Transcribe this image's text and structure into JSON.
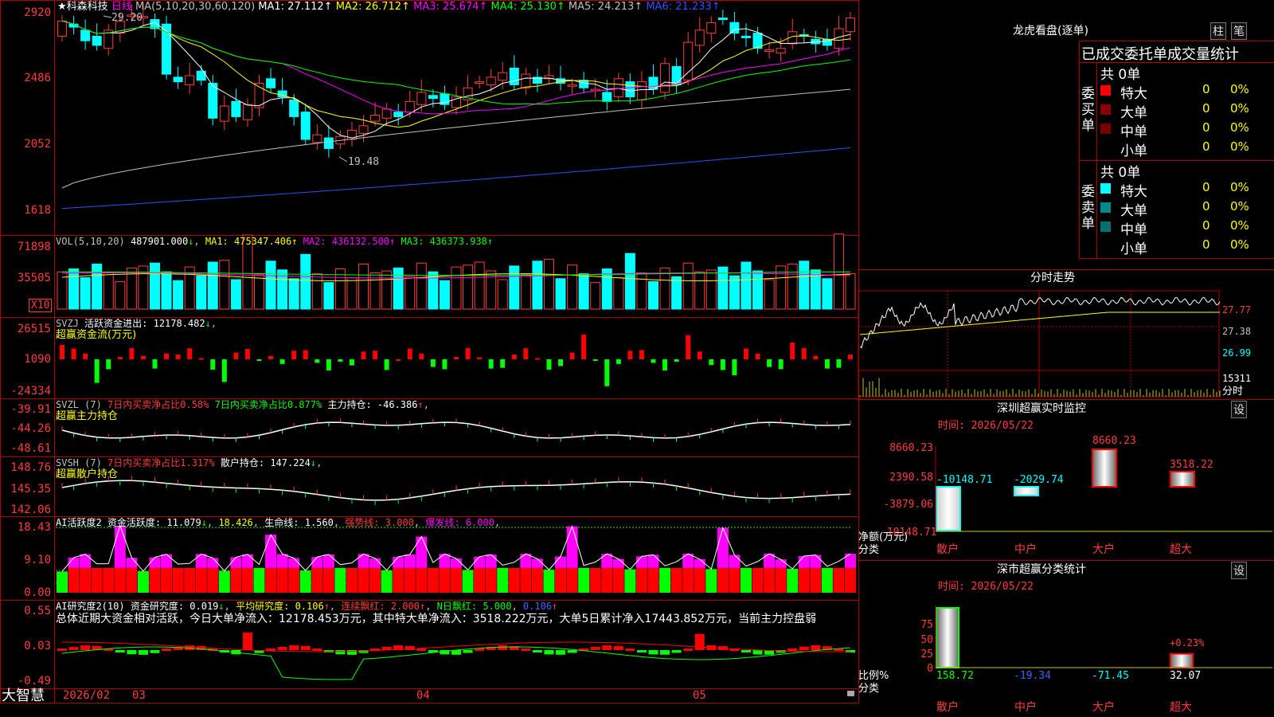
{
  "stock": {
    "name": "科森科技",
    "star": "★",
    "period": "日线"
  },
  "kline": {
    "ma_label": "MA(5,10,20,30,60,120)",
    "ma": [
      {
        "label": "MA1:",
        "value": "27.112",
        "color": "#ffffff"
      },
      {
        "label": "MA2:",
        "value": "26.712",
        "color": "#ffff00"
      },
      {
        "label": "MA3:",
        "value": "25.674",
        "color": "#ff00ff"
      },
      {
        "label": "MA4:",
        "value": "25.130",
        "color": "#00ff00"
      },
      {
        "label": "MA5:",
        "value": "24.213",
        "color": "#c0c0c0"
      },
      {
        "label": "MA6:",
        "value": "21.233",
        "color": "#3050ff"
      }
    ],
    "yticks": [
      "2920",
      "2486",
      "2052",
      "1618"
    ],
    "high_mark": "29.20",
    "low_mark": "19.48"
  },
  "vol": {
    "label": "VOL(5,10,20)",
    "value": "487901.000",
    "ma": [
      {
        "label": "MA1:",
        "value": "475347.406",
        "color": "#ffff00"
      },
      {
        "label": "MA2:",
        "value": "436132.500",
        "color": "#ff00ff"
      },
      {
        "label": "MA3:",
        "value": "436373.938",
        "color": "#00ff00"
      }
    ],
    "yticks": [
      "71898",
      "35505"
    ],
    "unit": "X10"
  },
  "svzj": {
    "label": "SVZJ",
    "desc": "活跃资金进出:",
    "value": "12178.482",
    "subtitle": "超赢资金流(万元)",
    "yticks": [
      "26515",
      "1090",
      "-24334"
    ]
  },
  "svzl": {
    "label": "SVZL (7)",
    "t1": "7日内买卖净占比0.58%",
    "t2": "7日内买卖净占比0.877%",
    "t3": "主力持仓:",
    "v3": "-46.386",
    "subtitle": "超赢主力持仓",
    "yticks": [
      "-39.91",
      "-44.26",
      "-48.61"
    ]
  },
  "svsh": {
    "label": "SVSH (7)",
    "t1": "7日内买卖净占比1.317%",
    "t2": "散户持仓:",
    "v2": "147.224",
    "subtitle": "超赢散户持仓",
    "yticks": [
      "148.76",
      "145.35",
      "142.06"
    ]
  },
  "ai1": {
    "label": "AI活跃度2",
    "t1": "资金活跃度:",
    "v1": "11.079",
    "v2": "18.426",
    "t3": "生命线:",
    "v3": "1.560",
    "t4": "强势线:",
    "v4": "3.000",
    "t5": "爆发线:",
    "v5": "6.000",
    "yticks": [
      "18.43",
      "9.10",
      "0.00"
    ]
  },
  "ai2": {
    "label": "AI研究度2(10)",
    "t1": "资金研究度:",
    "v1": "0.019",
    "t2": "平均研究度:",
    "v2": "0.106",
    "t3": "连续飘红:",
    "v3": "2.000",
    "t4": "N日飘红:",
    "v4": "5.000",
    "v5": "0.106",
    "summary": "总体近期大资金相对活跃，今日大单净流入：12178.453万元，其中特大单净流入：3518.222万元，大单5日累计净入17443.852万元，当前主力控盘弱",
    "yticks": [
      "0.55",
      "0.03",
      "-0.49"
    ]
  },
  "xaxis": {
    "brand": "大智慧",
    "labels": [
      "2026/02",
      "03",
      "04",
      "05"
    ]
  },
  "lhb": {
    "title": "龙虎看盘(逐单)",
    "btn1": "柱",
    "btn2": "笔",
    "header": "已成交委托单成交量统计",
    "buy": {
      "side": "委买单",
      "total": "共 0单",
      "rows": [
        {
          "name": "特大",
          "count": "0",
          "pct": "0%",
          "color": "#ff0000"
        },
        {
          "name": "大单",
          "count": "0",
          "pct": "0%",
          "color": "#8b0000"
        },
        {
          "name": "中单",
          "count": "0",
          "pct": "0%",
          "color": "#7a0000"
        },
        {
          "name": "小单",
          "count": "0",
          "pct": "0%",
          "color": ""
        }
      ]
    },
    "sell": {
      "side": "委卖单",
      "total": "共 0单",
      "rows": [
        {
          "name": "特大",
          "count": "0",
          "pct": "0%",
          "color": "#00ffff"
        },
        {
          "name": "大单",
          "count": "0",
          "pct": "0%",
          "color": "#008b8b"
        },
        {
          "name": "中单",
          "count": "0",
          "pct": "0%",
          "color": "#007070"
        },
        {
          "name": "小单",
          "count": "0",
          "pct": "0%",
          "color": ""
        }
      ]
    }
  },
  "fenshi": {
    "title": "分时走势",
    "p1": "27.77",
    "p2": "27.38",
    "p3": "26.99",
    "vol": "15311",
    "unit": "分时"
  },
  "monitor": {
    "title": "深圳超赢实时监控",
    "btn": "设",
    "time": "时间: 2026/05/22",
    "yticks": [
      "8660.23",
      "2390.58",
      "-3879.06",
      "-10148.71"
    ],
    "ylabel": "净额(万元)",
    "xlabel": "分类",
    "categories": [
      "散户",
      "中户",
      "大户",
      "超大"
    ],
    "values": [
      "-10148.71",
      "-2029.74",
      "8660.23",
      "3518.22"
    ]
  },
  "classify": {
    "title": "深市超赢分类统计",
    "btn": "设",
    "time": "时间: 2026/05/22",
    "yticks": [
      "75",
      "50",
      "25",
      "0"
    ],
    "ylabel": "比例%",
    "xlabel": "分类",
    "categories": [
      "散户",
      "中户",
      "大户",
      "超大"
    ],
    "values": [
      "158.72",
      "-19.34",
      "-71.45",
      "32.07"
    ],
    "pct_label": "+0.23%"
  },
  "chart_data": [
    {
      "type": "candlestick",
      "title": "科森科技 日线",
      "ylim": [
        16.18,
        29.2
      ],
      "x": [
        "2026/02",
        "03",
        "04",
        "05"
      ],
      "close": [
        28.6,
        28.2,
        27.3,
        27.0,
        28.0,
        28.6,
        29.0,
        28.9,
        28.1,
        25.1,
        24.6,
        25.0,
        24.7,
        22.2,
        23.0,
        22.3,
        23.1,
        24.5,
        24.2,
        23.6,
        22.3,
        20.8,
        21.1,
        20.2,
        21.0,
        21.4,
        21.7,
        22.4,
        22.8,
        22.3,
        23.3,
        23.9,
        23.5,
        23.1,
        23.6,
        24.2,
        24.6,
        24.9,
        25.2,
        24.4,
        25.1,
        24.5,
        25.0,
        24.5,
        24.4,
        24.2,
        24.1,
        23.3,
        24.8,
        23.6,
        24.6,
        24.1,
        25.8,
        24.4,
        27.2,
        28.0,
        28.5,
        28.7,
        27.8,
        27.5,
        26.8,
        26.7,
        26.8,
        27.9,
        27.6,
        27.1,
        27.0,
        28.1,
        28.8
      ]
    }
  ]
}
